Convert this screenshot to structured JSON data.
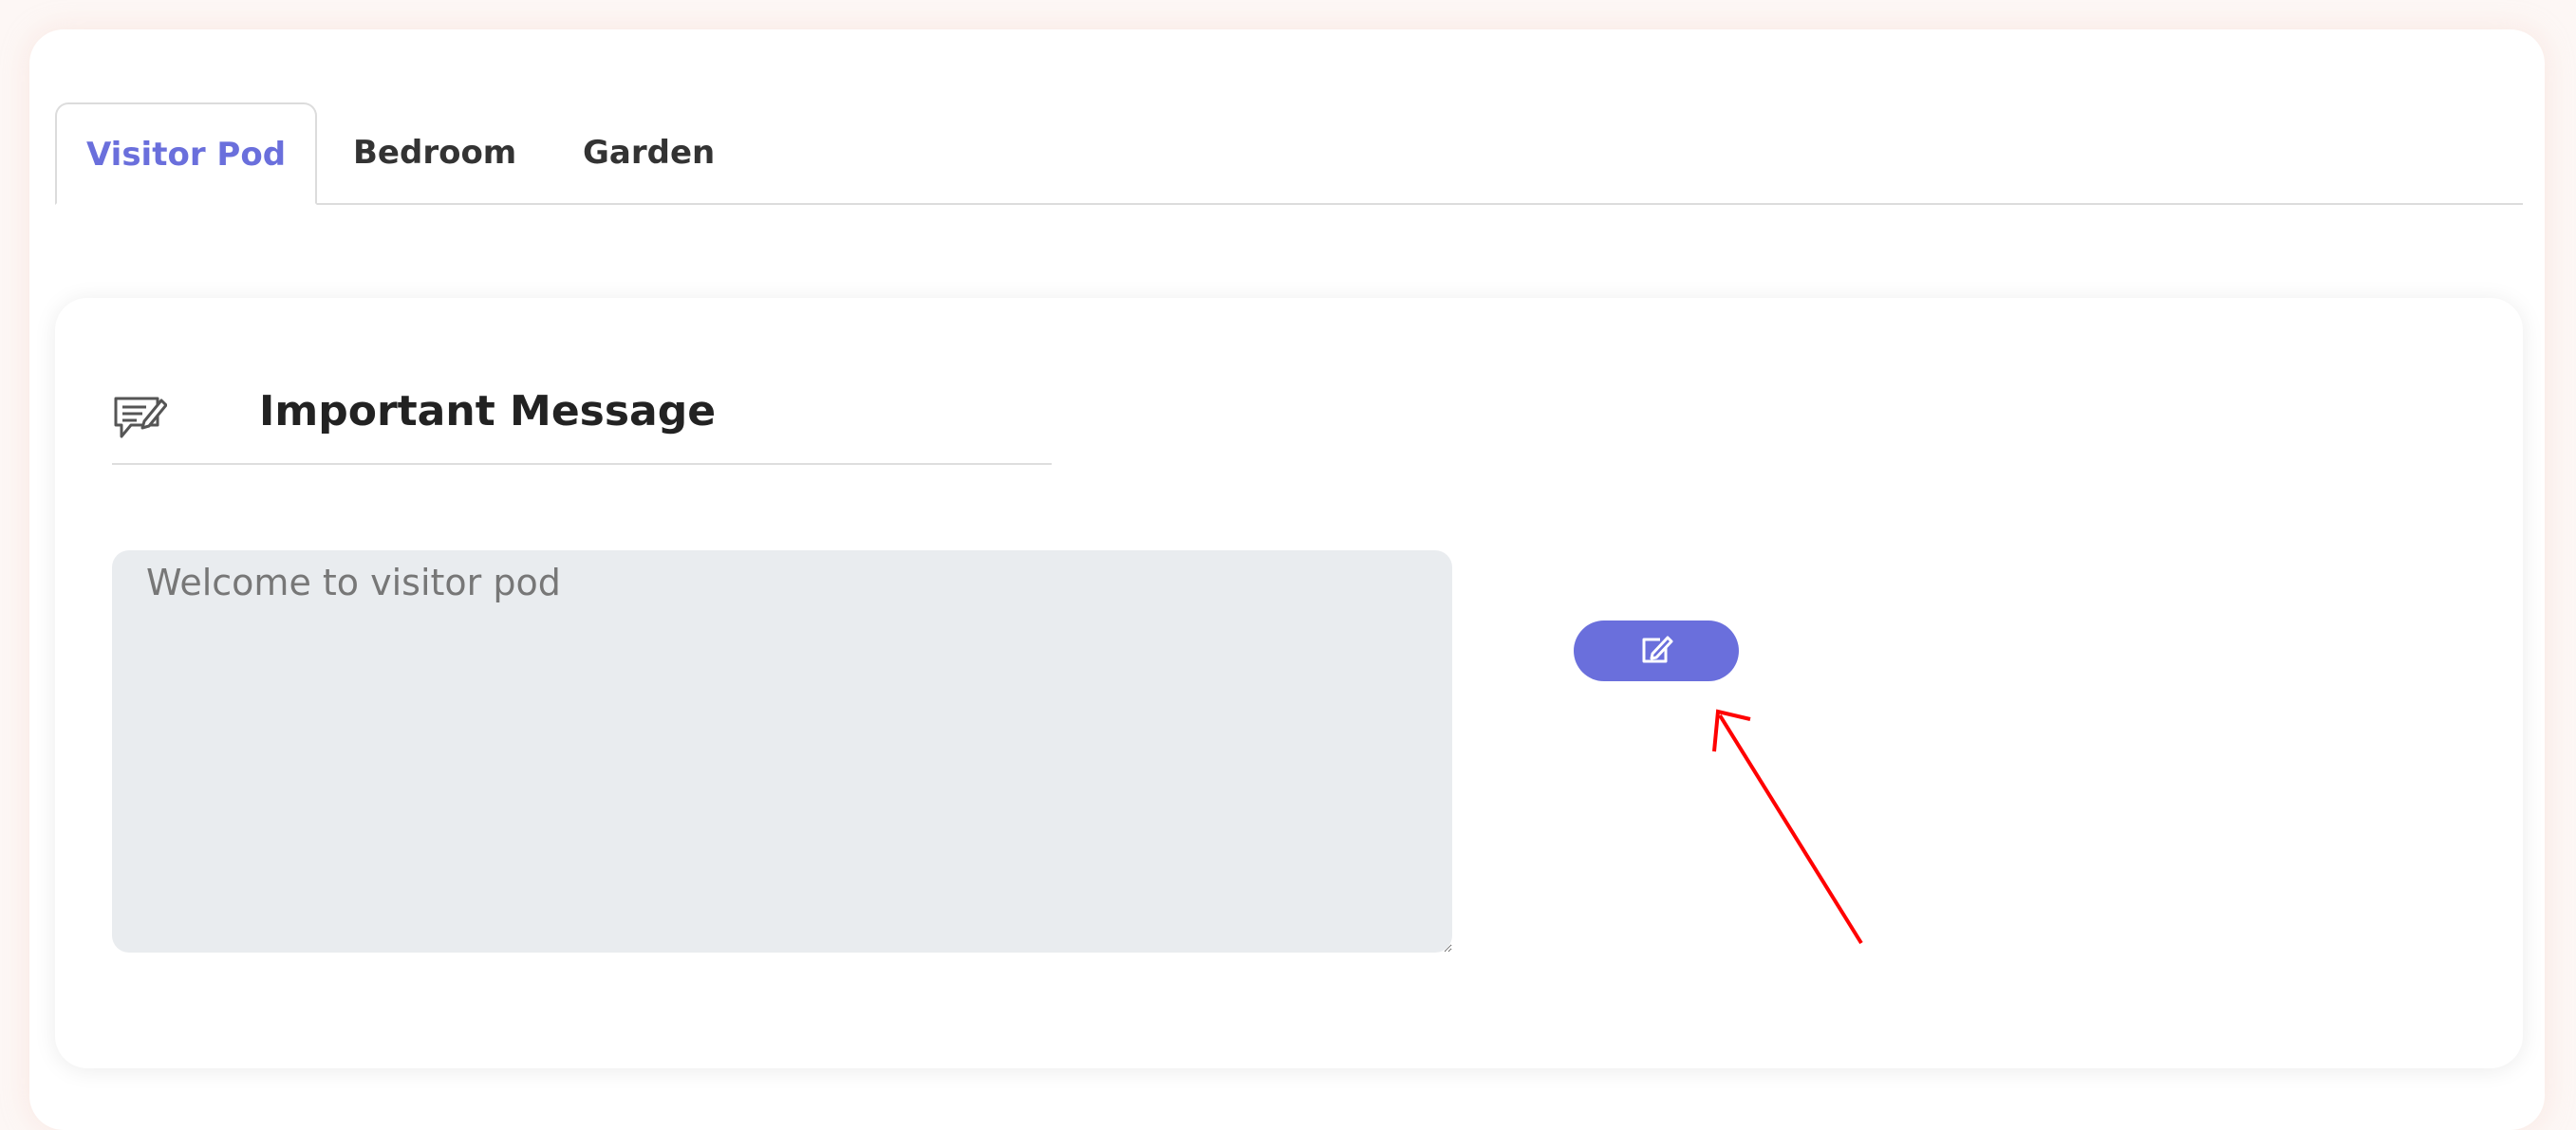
{
  "tabs": [
    {
      "label": "Visitor Pod",
      "active": true
    },
    {
      "label": "Bedroom",
      "active": false
    },
    {
      "label": "Garden",
      "active": false
    }
  ],
  "message_card": {
    "icon": "message-edit-icon",
    "title": "Important Message",
    "textarea_value": "Welcome to visitor pod",
    "edit_button_icon": "edit-icon"
  },
  "colors": {
    "accent": "#6a6fdc",
    "annotation": "#ff0000",
    "textarea_bg": "#e9ecef"
  }
}
